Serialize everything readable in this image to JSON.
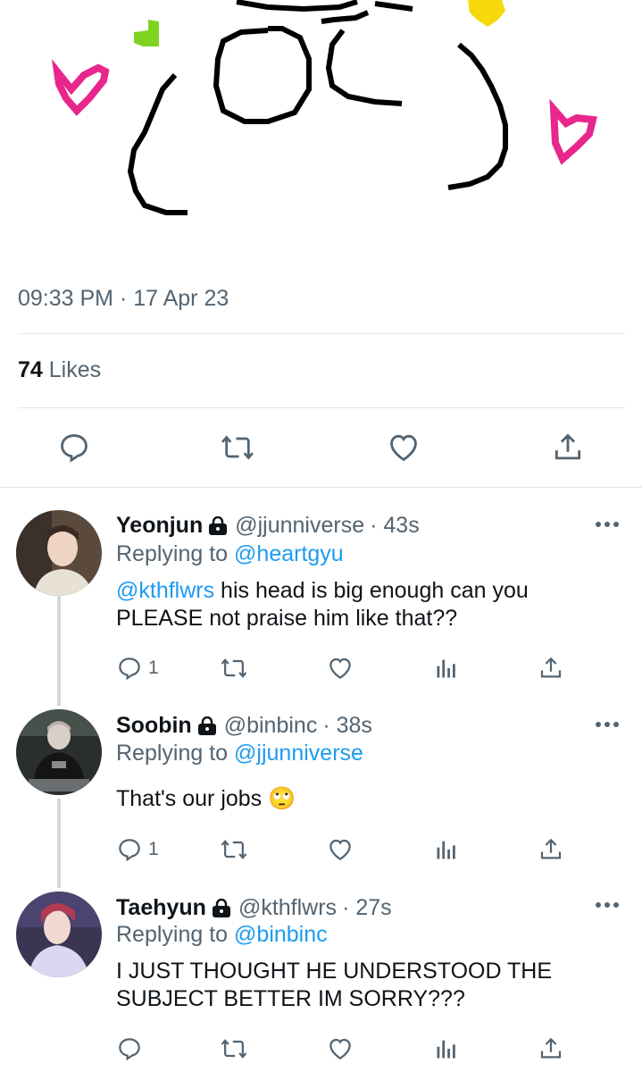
{
  "tweet": {
    "timestamp": "09:33 PM · 17 Apr 23",
    "likes_count": "74",
    "likes_label": "Likes"
  },
  "colors": {
    "text": "#0f1419",
    "secondary": "#536471",
    "link": "#1d9bf0",
    "divider": "#e1e4e8",
    "heart_pink": "#e8268c",
    "doodle_green": "#7ed321",
    "doodle_yellow": "#f5d90a"
  },
  "replies": [
    {
      "name": "Yeonjun",
      "handle": "@jjunniverse",
      "time": "· 43s",
      "replying_label": "Replying to",
      "replying_to": "@heartgyu",
      "mention": "@kthflwrs",
      "text": " his head is big enough can you PLEASE not praise him like that??",
      "reply_count": "1"
    },
    {
      "name": "Soobin",
      "handle": "@binbinc",
      "time": "· 38s",
      "replying_label": "Replying to",
      "replying_to": "@jjunniverse",
      "mention": "",
      "text": "That's our jobs 🙄",
      "reply_count": "1"
    },
    {
      "name": "Taehyun",
      "handle": "@kthflwrs",
      "time": "· 27s",
      "replying_label": "Replying to",
      "replying_to": "@binbinc",
      "mention": "",
      "text": "I JUST THOUGHT HE UNDERSTOOD THE SUBJECT BETTER IM SORRY???",
      "reply_count": ""
    }
  ]
}
